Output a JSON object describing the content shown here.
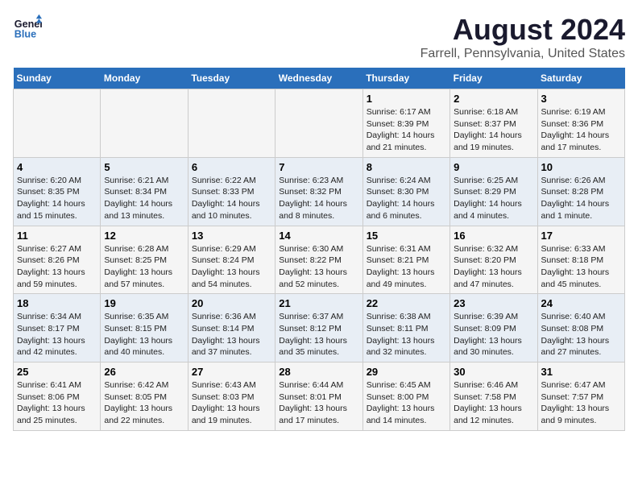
{
  "header": {
    "logo_line1": "General",
    "logo_line2": "Blue",
    "main_title": "August 2024",
    "subtitle": "Farrell, Pennsylvania, United States"
  },
  "days_of_week": [
    "Sunday",
    "Monday",
    "Tuesday",
    "Wednesday",
    "Thursday",
    "Friday",
    "Saturday"
  ],
  "weeks": [
    [
      {
        "day": "",
        "info": ""
      },
      {
        "day": "",
        "info": ""
      },
      {
        "day": "",
        "info": ""
      },
      {
        "day": "",
        "info": ""
      },
      {
        "day": "1",
        "info": "Sunrise: 6:17 AM\nSunset: 8:39 PM\nDaylight: 14 hours\nand 21 minutes."
      },
      {
        "day": "2",
        "info": "Sunrise: 6:18 AM\nSunset: 8:37 PM\nDaylight: 14 hours\nand 19 minutes."
      },
      {
        "day": "3",
        "info": "Sunrise: 6:19 AM\nSunset: 8:36 PM\nDaylight: 14 hours\nand 17 minutes."
      }
    ],
    [
      {
        "day": "4",
        "info": "Sunrise: 6:20 AM\nSunset: 8:35 PM\nDaylight: 14 hours\nand 15 minutes."
      },
      {
        "day": "5",
        "info": "Sunrise: 6:21 AM\nSunset: 8:34 PM\nDaylight: 14 hours\nand 13 minutes."
      },
      {
        "day": "6",
        "info": "Sunrise: 6:22 AM\nSunset: 8:33 PM\nDaylight: 14 hours\nand 10 minutes."
      },
      {
        "day": "7",
        "info": "Sunrise: 6:23 AM\nSunset: 8:32 PM\nDaylight: 14 hours\nand 8 minutes."
      },
      {
        "day": "8",
        "info": "Sunrise: 6:24 AM\nSunset: 8:30 PM\nDaylight: 14 hours\nand 6 minutes."
      },
      {
        "day": "9",
        "info": "Sunrise: 6:25 AM\nSunset: 8:29 PM\nDaylight: 14 hours\nand 4 minutes."
      },
      {
        "day": "10",
        "info": "Sunrise: 6:26 AM\nSunset: 8:28 PM\nDaylight: 14 hours\nand 1 minute."
      }
    ],
    [
      {
        "day": "11",
        "info": "Sunrise: 6:27 AM\nSunset: 8:26 PM\nDaylight: 13 hours\nand 59 minutes."
      },
      {
        "day": "12",
        "info": "Sunrise: 6:28 AM\nSunset: 8:25 PM\nDaylight: 13 hours\nand 57 minutes."
      },
      {
        "day": "13",
        "info": "Sunrise: 6:29 AM\nSunset: 8:24 PM\nDaylight: 13 hours\nand 54 minutes."
      },
      {
        "day": "14",
        "info": "Sunrise: 6:30 AM\nSunset: 8:22 PM\nDaylight: 13 hours\nand 52 minutes."
      },
      {
        "day": "15",
        "info": "Sunrise: 6:31 AM\nSunset: 8:21 PM\nDaylight: 13 hours\nand 49 minutes."
      },
      {
        "day": "16",
        "info": "Sunrise: 6:32 AM\nSunset: 8:20 PM\nDaylight: 13 hours\nand 47 minutes."
      },
      {
        "day": "17",
        "info": "Sunrise: 6:33 AM\nSunset: 8:18 PM\nDaylight: 13 hours\nand 45 minutes."
      }
    ],
    [
      {
        "day": "18",
        "info": "Sunrise: 6:34 AM\nSunset: 8:17 PM\nDaylight: 13 hours\nand 42 minutes."
      },
      {
        "day": "19",
        "info": "Sunrise: 6:35 AM\nSunset: 8:15 PM\nDaylight: 13 hours\nand 40 minutes."
      },
      {
        "day": "20",
        "info": "Sunrise: 6:36 AM\nSunset: 8:14 PM\nDaylight: 13 hours\nand 37 minutes."
      },
      {
        "day": "21",
        "info": "Sunrise: 6:37 AM\nSunset: 8:12 PM\nDaylight: 13 hours\nand 35 minutes."
      },
      {
        "day": "22",
        "info": "Sunrise: 6:38 AM\nSunset: 8:11 PM\nDaylight: 13 hours\nand 32 minutes."
      },
      {
        "day": "23",
        "info": "Sunrise: 6:39 AM\nSunset: 8:09 PM\nDaylight: 13 hours\nand 30 minutes."
      },
      {
        "day": "24",
        "info": "Sunrise: 6:40 AM\nSunset: 8:08 PM\nDaylight: 13 hours\nand 27 minutes."
      }
    ],
    [
      {
        "day": "25",
        "info": "Sunrise: 6:41 AM\nSunset: 8:06 PM\nDaylight: 13 hours\nand 25 minutes."
      },
      {
        "day": "26",
        "info": "Sunrise: 6:42 AM\nSunset: 8:05 PM\nDaylight: 13 hours\nand 22 minutes."
      },
      {
        "day": "27",
        "info": "Sunrise: 6:43 AM\nSunset: 8:03 PM\nDaylight: 13 hours\nand 19 minutes."
      },
      {
        "day": "28",
        "info": "Sunrise: 6:44 AM\nSunset: 8:01 PM\nDaylight: 13 hours\nand 17 minutes."
      },
      {
        "day": "29",
        "info": "Sunrise: 6:45 AM\nSunset: 8:00 PM\nDaylight: 13 hours\nand 14 minutes."
      },
      {
        "day": "30",
        "info": "Sunrise: 6:46 AM\nSunset: 7:58 PM\nDaylight: 13 hours\nand 12 minutes."
      },
      {
        "day": "31",
        "info": "Sunrise: 6:47 AM\nSunset: 7:57 PM\nDaylight: 13 hours\nand 9 minutes."
      }
    ]
  ]
}
